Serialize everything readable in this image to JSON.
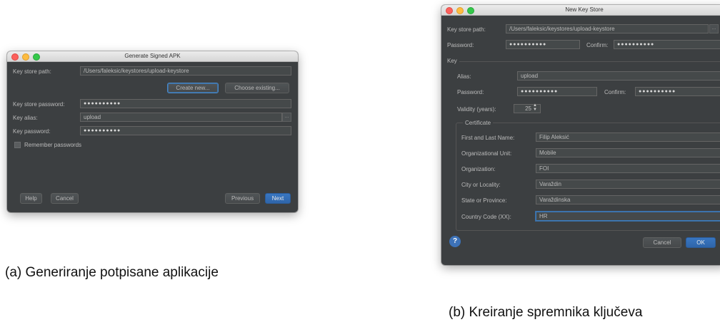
{
  "apk": {
    "title": "Generate Signed APK",
    "keystore_path_label": "Key store path:",
    "keystore_path_value": "/Users/faleksic/keystores/upload-keystore",
    "create_new": "Create new...",
    "choose_existing": "Choose existing...",
    "keystore_password_label": "Key store password:",
    "keystore_password_value": "●●●●●●●●●●",
    "key_alias_label": "Key alias:",
    "key_alias_value": "upload",
    "alias_browse": "...",
    "key_password_label": "Key password:",
    "key_password_value": "●●●●●●●●●●",
    "remember_label": "Remember passwords",
    "help": "Help",
    "cancel": "Cancel",
    "previous": "Previous",
    "next": "Next"
  },
  "keystore": {
    "title": "New Key Store",
    "path_label": "Key store path:",
    "path_value": "/Users/faleksic/keystores/upload-keystore",
    "path_browse": "...",
    "password_label": "Password:",
    "password_value": "●●●●●●●●●●",
    "confirm_label": "Confirm:",
    "confirm_value": "●●●●●●●●●●",
    "key_group": "Key",
    "alias_label": "Alias:",
    "alias_value": "upload",
    "key_password_label": "Password:",
    "key_password_value": "●●●●●●●●●●",
    "key_confirm_label": "Confirm:",
    "key_confirm_value": "●●●●●●●●●●",
    "validity_label": "Validity (years):",
    "validity_value": "25",
    "certificate_group": "Certificate",
    "cert_fields": [
      {
        "label": "First and Last Name:",
        "value": "Filip Aleksić"
      },
      {
        "label": "Organizational Unit:",
        "value": "Mobile"
      },
      {
        "label": "Organization:",
        "value": "FOI"
      },
      {
        "label": "City or Locality:",
        "value": "Varaždin"
      },
      {
        "label": "State or Province:",
        "value": "Varaždinska"
      },
      {
        "label": "Country Code (XX):",
        "value": "HR"
      }
    ],
    "help_icon": "question-icon",
    "cancel": "Cancel",
    "ok": "OK"
  },
  "captions": {
    "a": "(a) Generiranje potpisane aplikacije",
    "b": "(b) Kreiranje spremnika ključeva"
  }
}
